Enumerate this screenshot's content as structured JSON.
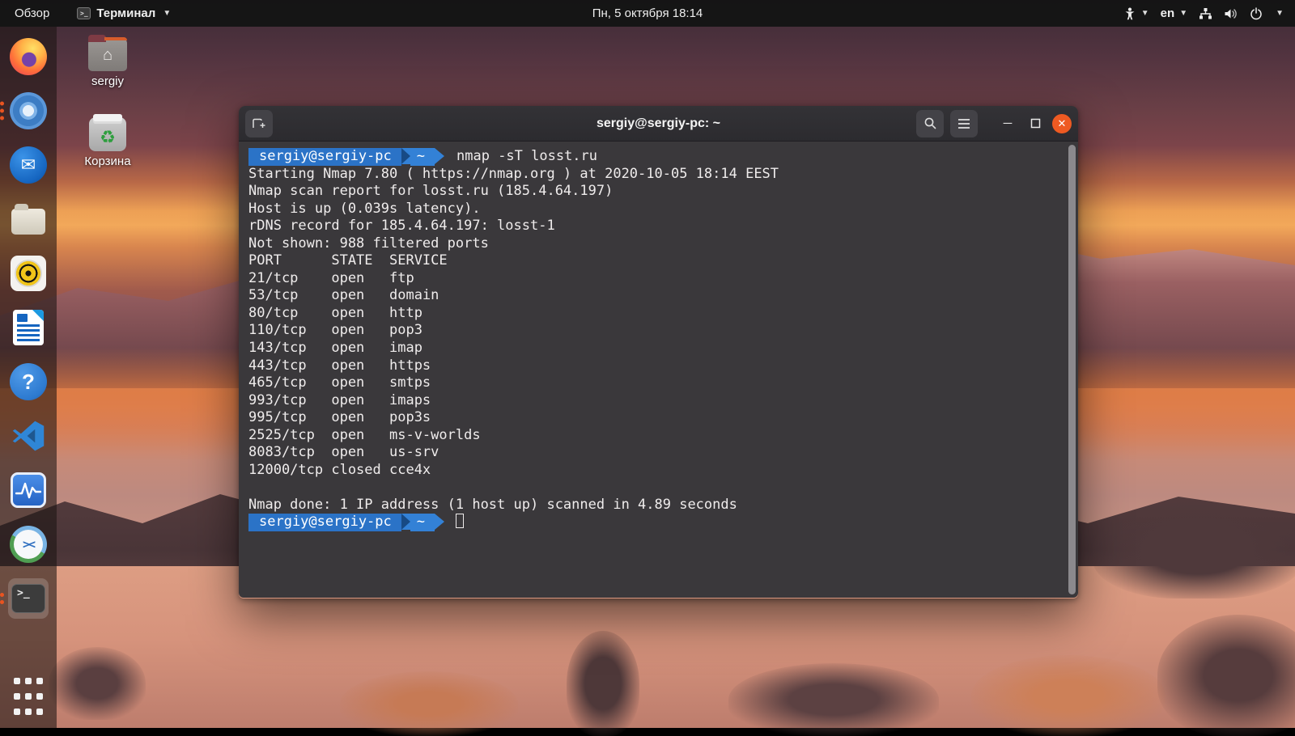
{
  "top_bar": {
    "activities_label": "Обзор",
    "app_menu_label": "Терминал",
    "clock": "Пн, 5 октября  18:14",
    "language": "en"
  },
  "dock": {
    "items": [
      "firefox",
      "chromium",
      "thunderbird",
      "files",
      "rhythmbox",
      "libreoffice-writer",
      "help",
      "vscode",
      "system-monitor",
      "remote-desktop",
      "terminal",
      "show-applications"
    ],
    "chromium_running_windows": 3,
    "terminal_running_windows": 2
  },
  "desktop": {
    "icons": [
      {
        "label": "sergiy"
      },
      {
        "label": "Корзина"
      }
    ]
  },
  "terminal_window": {
    "title": "sergiy@sergiy-pc: ~",
    "prompt": {
      "user_host": "sergiy@sergiy-pc",
      "cwd": "~"
    },
    "command": "nmap -sT losst.ru",
    "output": [
      "Starting Nmap 7.80 ( https://nmap.org ) at 2020-10-05 18:14 EEST",
      "Nmap scan report for losst.ru (185.4.64.197)",
      "Host is up (0.039s latency).",
      "rDNS record for 185.4.64.197: losst-1",
      "Not shown: 988 filtered ports",
      "PORT      STATE  SERVICE",
      "21/tcp    open   ftp",
      "53/tcp    open   domain",
      "80/tcp    open   http",
      "110/tcp   open   pop3",
      "143/tcp   open   imap",
      "443/tcp   open   https",
      "465/tcp   open   smtps",
      "993/tcp   open   imaps",
      "995/tcp   open   pop3s",
      "2525/tcp  open   ms-v-worlds",
      "8083/tcp  open   us-srv",
      "12000/tcp closed cce4x",
      "",
      "Nmap done: 1 IP address (1 host up) scanned in 4.89 seconds"
    ]
  },
  "colors": {
    "prompt_segment1": "#2b73c7",
    "prompt_segment2": "#3381d6",
    "prompt_divider": "#174a85",
    "terminal_background": "#3a383b",
    "close_button": "#ee5a22",
    "running_dot": "#e95420"
  }
}
